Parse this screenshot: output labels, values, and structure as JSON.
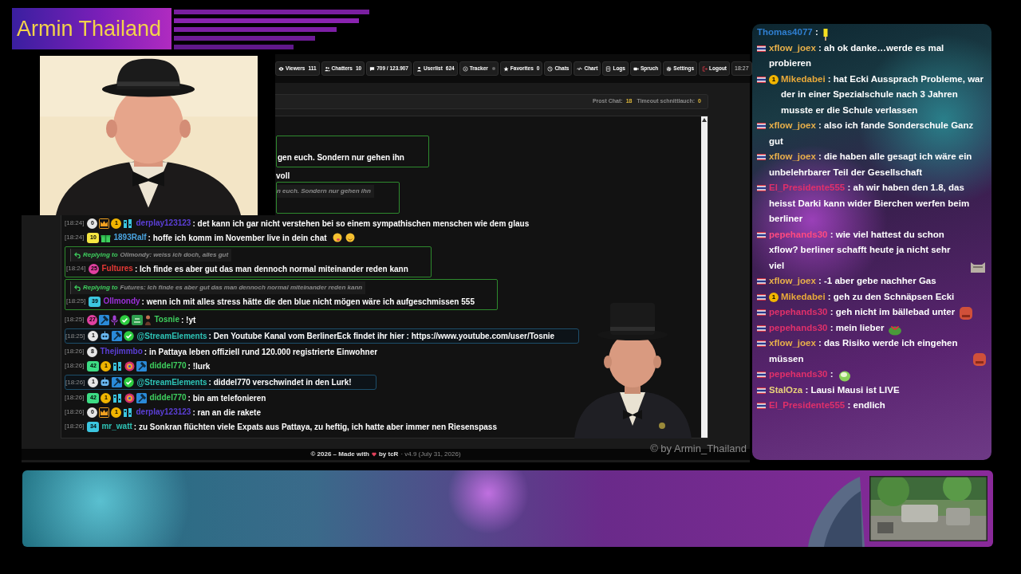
{
  "banner": {
    "title": "Armin Thailand"
  },
  "toolbar": {
    "buttons": [
      {
        "label": "Viewers",
        "count": "111"
      },
      {
        "label": "Chatters",
        "count": "10"
      },
      {
        "label": "709 / 123.907"
      },
      {
        "label": "Userlist",
        "count": "624"
      },
      {
        "label": "Tracker",
        "active": false
      },
      {
        "label": "Favorites",
        "count": "0"
      },
      {
        "label": "Chats"
      },
      {
        "label": "Chart"
      },
      {
        "label": "Logs"
      },
      {
        "label": "Spruch"
      },
      {
        "label": "Settings"
      },
      {
        "label": "Logout"
      }
    ],
    "clock": "18:27"
  },
  "stats": [
    {
      "label": "Prost Chat:",
      "value": "18"
    },
    {
      "label": "Timeout schnittlauch:",
      "value": "0"
    }
  ],
  "chat": {
    "messages": [
      {
        "kind": "fragment_box",
        "text": "gen euch. Sondern nur gehen ihn"
      },
      {
        "kind": "fragment",
        "text": "voll"
      },
      {
        "kind": "fragment_reply",
        "quote": "n euch. Sondern nur gehen ihn"
      },
      {
        "kind": "message",
        "time": "[18:24]",
        "badges": [
          {
            "kind": "circle",
            "text": "0",
            "color": "#e6e6e6"
          },
          {
            "kind": "crown"
          },
          {
            "kind": "circle",
            "text": "1",
            "color": "#f0b400"
          },
          {
            "kind": "bars"
          }
        ],
        "user": "derplay123123",
        "color": "#5b3fd6",
        "text": ": det kann ich gar nicht verstehen bei so einem sympathischen menschen wie dem glaus"
      },
      {
        "kind": "message",
        "time": "[18:24]",
        "badges": [
          {
            "kind": "square",
            "text": "10",
            "color": "#f5e642"
          },
          {
            "kind": "gift"
          }
        ],
        "user": "1893Ralf",
        "color": "#4aa3df",
        "text": ": hoffe ich komm im November live in dein chat",
        "emotes": [
          {
            "kind": "tongue"
          },
          {
            "kind": "smile"
          }
        ]
      },
      {
        "kind": "reply",
        "reply_label": "Replying to",
        "quote": "Ollmondy: weiss ich doch, alles gut",
        "time": "[18:24]",
        "badges": [
          {
            "kind": "circle",
            "text": "25",
            "color": "#e040a0"
          }
        ],
        "user": "Fultures",
        "color": "#e53935",
        "text": ": Ich finde es aber gut das man dennoch normal miteinander reden kann"
      },
      {
        "kind": "reply",
        "reply_label": "Replying to",
        "quote": "Futures: Ich finde es aber gut das man dennoch normal miteinander reden kann",
        "time": "[18:25]",
        "badges": [
          {
            "kind": "square",
            "text": "39",
            "color": "#3cc6e0"
          }
        ],
        "user": "Ollmondy",
        "color": "#9b30d9",
        "text": ": wenn ich mit alles stress hätte die den blue nicht mögen wäre ich aufgeschmissen 555"
      },
      {
        "kind": "message",
        "time": "[18:25]",
        "badges": [
          {
            "kind": "circle",
            "text": "27",
            "color": "#e040a0"
          },
          {
            "kind": "hammer"
          },
          {
            "kind": "mic"
          },
          {
            "kind": "verified"
          },
          {
            "kind": "emote"
          },
          {
            "kind": "figure"
          }
        ],
        "user": "Tosnie",
        "color": "#3ecf5e",
        "text": ": !yt"
      },
      {
        "kind": "highlight",
        "time": "[18:25]",
        "badges": [
          {
            "kind": "circle",
            "text": "1",
            "color": "#e6e6e6"
          },
          {
            "kind": "bot"
          },
          {
            "kind": "hammer"
          },
          {
            "kind": "verified"
          }
        ],
        "user": "@StreamElements",
        "color": "#2ec4b6",
        "text": ": Den Youtube Kanal vom BerlinerEck findet ihr hier : https://www.youtube.com/user/Tosnie"
      },
      {
        "kind": "message",
        "time": "[18:26]",
        "badges": [
          {
            "kind": "circle",
            "text": "8",
            "color": "#e6e6e6"
          }
        ],
        "user": "Thejimmbo",
        "color": "#5b3fd6",
        "text": ": in Pattaya leben offiziell rund 120.000 registrierte Einwohner"
      },
      {
        "kind": "message",
        "time": "[18:26]",
        "badges": [
          {
            "kind": "square",
            "text": "42",
            "color": "#3ddc84"
          },
          {
            "kind": "circle",
            "text": "1",
            "color": "#f0b400"
          },
          {
            "kind": "bars"
          },
          {
            "kind": "medal"
          },
          {
            "kind": "hammer"
          }
        ],
        "user": "diddel770",
        "color": "#3ecf5e",
        "text": ": !lurk"
      },
      {
        "kind": "highlight",
        "time": "[18:26]",
        "badges": [
          {
            "kind": "circle",
            "text": "1",
            "color": "#e6e6e6"
          },
          {
            "kind": "bot"
          },
          {
            "kind": "hammer"
          },
          {
            "kind": "verified"
          }
        ],
        "user": "@StreamElements",
        "color": "#2ec4b6",
        "text": ": diddel770 verschwindet in den Lurk!"
      },
      {
        "kind": "message",
        "time": "[18:26]",
        "badges": [
          {
            "kind": "square",
            "text": "42",
            "color": "#3ddc84"
          },
          {
            "kind": "circle",
            "text": "1",
            "color": "#f0b400"
          },
          {
            "kind": "bars"
          },
          {
            "kind": "medal"
          },
          {
            "kind": "hammer"
          }
        ],
        "user": "diddel770",
        "color": "#3ecf5e",
        "text": ": bin am telefonieren"
      },
      {
        "kind": "message",
        "time": "[18:26]",
        "badges": [
          {
            "kind": "circle",
            "text": "0",
            "color": "#e6e6e6"
          },
          {
            "kind": "crown"
          },
          {
            "kind": "circle",
            "text": "1",
            "color": "#f0b400"
          },
          {
            "kind": "bars"
          }
        ],
        "user": "derplay123123",
        "color": "#5b3fd6",
        "text": ": ran an die rakete"
      },
      {
        "kind": "message",
        "time": "[18:26]",
        "badges": [
          {
            "kind": "square",
            "text": "34",
            "color": "#3cc6e0"
          }
        ],
        "user": "mr_watt",
        "color": "#2ec4b6",
        "text": ": zu Sonkran flüchten viele Expats aus Pattaya, zu heftig, ich hatte aber immer nen Riesenspass"
      }
    ]
  },
  "footer": {
    "copyright": "© 2026 – Made with",
    "by": "by tcR",
    "version": "· v4.9 (July 31, 2026)"
  },
  "watermark": "© by Armin_Thailand",
  "overlay_chat": {
    "messages": [
      {
        "flag": false,
        "user": "Thomas4077",
        "color": "#2f7fd1",
        "text": " :",
        "emotes": [
          {
            "kind": "candle"
          }
        ]
      },
      {
        "flag": true,
        "user": "xflow_joex",
        "color": "#e8b04a",
        "text": " : ah ok danke…werde es mal probieren"
      },
      {
        "flag": true,
        "badge": "1",
        "user": "Mikedabei",
        "color": "#e8a93a",
        "text": " : hat Ecki Aussprach Probleme, war der in einer Spezialschule nach 3 Jahren musste er die Schule verlassen"
      },
      {
        "flag": true,
        "user": "xflow_joex",
        "color": "#e8b04a",
        "text": " : also ich fande Sonderschule Ganz gut"
      },
      {
        "flag": true,
        "user": "xflow_joex",
        "color": "#e8b04a",
        "text": " : die haben alle gesagt ich wäre ein unbelehrbarer Teil der Gesellschaft"
      },
      {
        "flag": true,
        "user": "El_Presidente555",
        "color": "#e0306a",
        "text": " : ah wir haben den 1.8, das heisst Darki kann wider Bierchen werfen beim berliner"
      },
      {
        "flag": true,
        "user": "pepehands30",
        "color": "#ff4a80",
        "text": " : wie viel hattest du schon xflow? berliner schafft heute ja nicht sehr viel",
        "emotes": [
          {
            "kind": "cat"
          }
        ]
      },
      {
        "flag": true,
        "user": "xflow_joex",
        "color": "#e8b04a",
        "text": " : -1 aber gebe nachher Gas"
      },
      {
        "flag": true,
        "badge": "1",
        "user": "Mikedabei",
        "color": "#e8a93a",
        "text": " : geh zu den Schnäpsen Ecki"
      },
      {
        "flag": true,
        "user": "pepehands30",
        "color": "#e0306a",
        "text": " : geh nicht im bällebad unter",
        "emotes": [
          {
            "kind": "red"
          }
        ]
      },
      {
        "flag": true,
        "user": "pepehands30",
        "color": "#e0306a",
        "text": " : mein lieber",
        "emotes": [
          {
            "kind": "frog"
          }
        ]
      },
      {
        "flag": true,
        "user": "xflow_joex",
        "color": "#e8b04a",
        "text": " : das Risiko werde ich eingehen müssen",
        "emotes": [
          {
            "kind": "red"
          }
        ]
      },
      {
        "flag": true,
        "user": "pepehands30",
        "color": "#e0306a",
        "text": " :",
        "emotes": [
          {
            "kind": "leaf"
          }
        ]
      },
      {
        "flag": true,
        "user": "StalOza",
        "color": "#e8d27a",
        "text": " : Lausi Mausi ist LIVE"
      },
      {
        "flag": true,
        "user": "El_Presidente555",
        "color": "#e0306a",
        "text": " : endlich"
      }
    ]
  }
}
